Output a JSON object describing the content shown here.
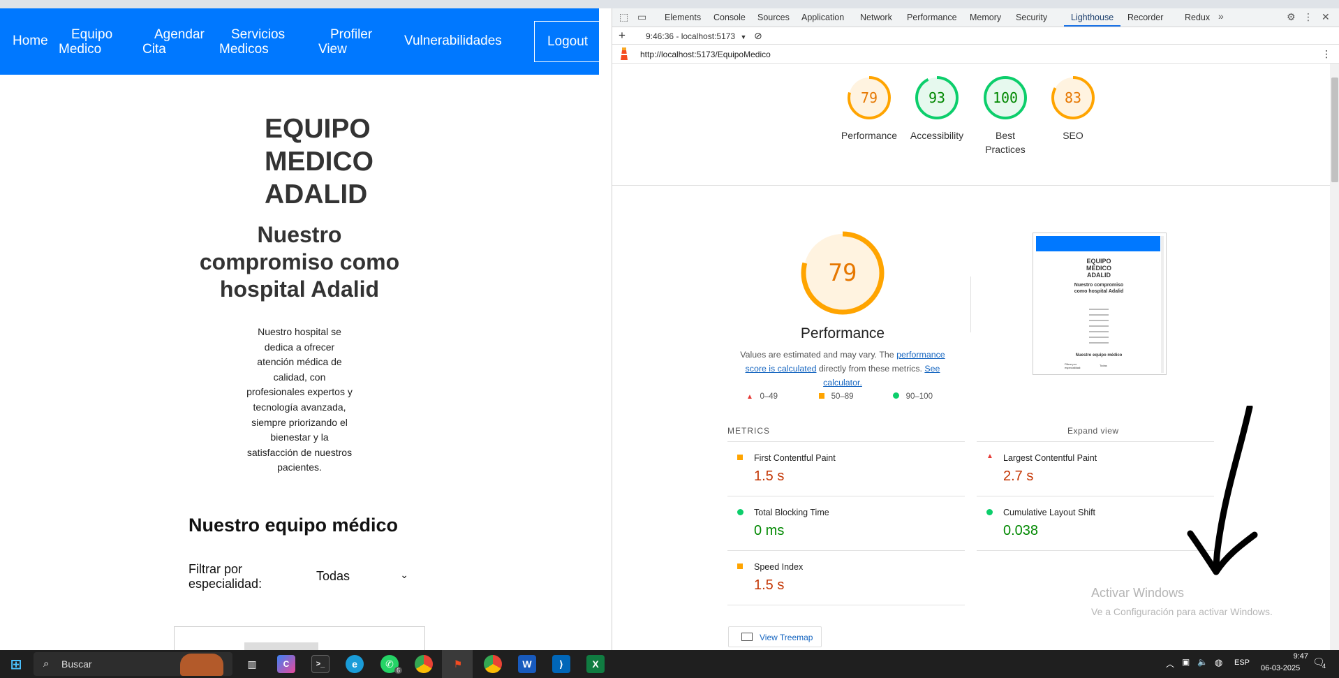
{
  "page": {
    "nav": {
      "items": [
        "Home",
        "Equipo Medico",
        "Agendar Cita",
        "Servicios Medicos",
        "Profiler View",
        "Vulnerabilidades"
      ],
      "logout": "Logout"
    },
    "title": "EQUIPO MEDICO ADALID",
    "subtitle": "Nuestro compromiso como hospital Adalid",
    "paragraph": "Nuestro hospital se dedica a ofrecer atención médica de calidad, con profesionales expertos y tecnología avanzada, siempre priorizando el bienestar y la satisfacción de nuestros pacientes.",
    "team_heading": "Nuestro equipo médico",
    "filter_label": "Filtrar por especialidad:",
    "filter_value": "Todas"
  },
  "devtools": {
    "tabs": [
      "Elements",
      "Console",
      "Sources",
      "Application",
      "Network",
      "Performance",
      "Memory",
      "Security",
      "Lighthouse",
      "Recorder",
      "Redux"
    ],
    "active_tab": "Lighthouse",
    "report_selector": "9:46:36 - localhost:5173",
    "url": "http://localhost:5173/EquipoMedico",
    "scores": [
      {
        "label": "Performance",
        "value": "79",
        "color": "#e67700",
        "ring": "#ffa400"
      },
      {
        "label": "Accessibility",
        "value": "93",
        "color": "#008800",
        "ring": "#0cce6b"
      },
      {
        "label": "Best Practices",
        "value": "100",
        "color": "#008800",
        "ring": "#0cce6b"
      },
      {
        "label": "SEO",
        "value": "83",
        "color": "#e67700",
        "ring": "#ffa400"
      }
    ],
    "performance_title": "Performance",
    "perf_note_1": "Values are estimated and may vary. The ",
    "perf_note_link1": "performance score is calculated",
    "perf_note_2": " directly from these metrics. ",
    "perf_note_link2": "See calculator.",
    "legend": [
      "0–49",
      "50–89",
      "90–100"
    ],
    "metrics_heading": "METRICS",
    "expand_view": "Expand view",
    "metrics": [
      {
        "label": "First Contentful Paint",
        "value": "1.5 s",
        "status": "average"
      },
      {
        "label": "Largest Contentful Paint",
        "value": "2.7 s",
        "status": "fail"
      },
      {
        "label": "Total Blocking Time",
        "value": "0 ms",
        "status": "pass"
      },
      {
        "label": "Cumulative Layout Shift",
        "value": "0.038",
        "status": "pass"
      },
      {
        "label": "Speed Index",
        "value": "1.5 s",
        "status": "average"
      }
    ],
    "treemap_button": "View Treemap",
    "watermark_title": "Activar Windows",
    "watermark_sub": "Ve a Configuración para activar Windows."
  },
  "thumbnail": {
    "title": "EQUIPO MEDICO ADALID",
    "subtitle": "Nuestro compromiso como hospital Adalid",
    "team": "Nuestro equipo médico",
    "filter": "Filtrar por especialidad:",
    "filter_value": "Todas"
  },
  "taskbar": {
    "search_placeholder": "Buscar",
    "language": "ESP",
    "time": "9:47",
    "date": "06-03-2025",
    "whatsapp_badge": "6",
    "notification_count": "4"
  }
}
